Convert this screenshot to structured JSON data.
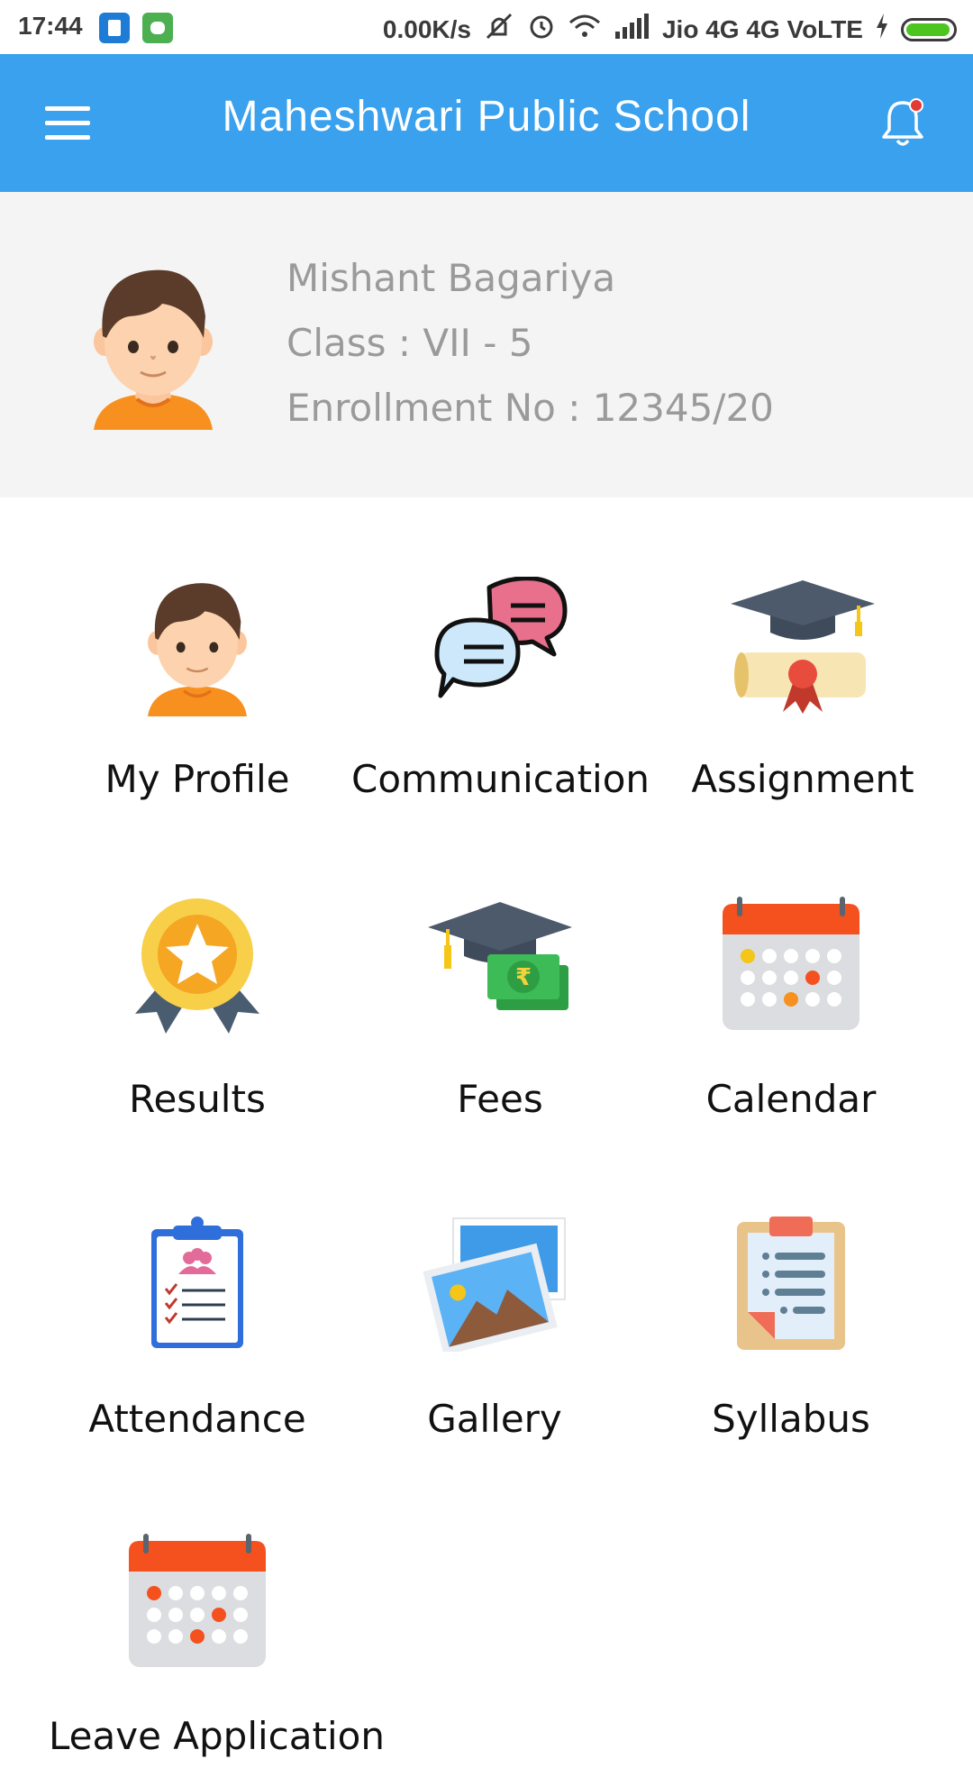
{
  "status_bar": {
    "time": "17:44",
    "net_speed": "0.00K/s",
    "carrier": "Jio 4G 4G VoLTE"
  },
  "app_bar": {
    "title": "Maheshwari Public School",
    "accent_color": "#3aa1ee"
  },
  "student": {
    "name": "Mishant Bagariya",
    "class_line": "Class : VII - 5",
    "enrollment_line": "Enrollment No : 12345/20"
  },
  "menu": {
    "items": [
      {
        "label": "My Profile",
        "icon": "boy-avatar-icon"
      },
      {
        "label": "Communication",
        "icon": "chat-bubbles-icon"
      },
      {
        "label": "Assignment",
        "icon": "graduation-cap-diploma-icon"
      },
      {
        "label": "Results",
        "icon": "award-medal-icon"
      },
      {
        "label": "Fees",
        "icon": "cap-money-icon"
      },
      {
        "label": "Calendar",
        "icon": "calendar-icon"
      },
      {
        "label": "Attendance",
        "icon": "clipboard-checklist-icon"
      },
      {
        "label": "Gallery",
        "icon": "photos-icon"
      },
      {
        "label": "Syllabus",
        "icon": "document-list-icon"
      },
      {
        "label": "Leave Application",
        "icon": "calendar-leave-icon"
      }
    ]
  }
}
